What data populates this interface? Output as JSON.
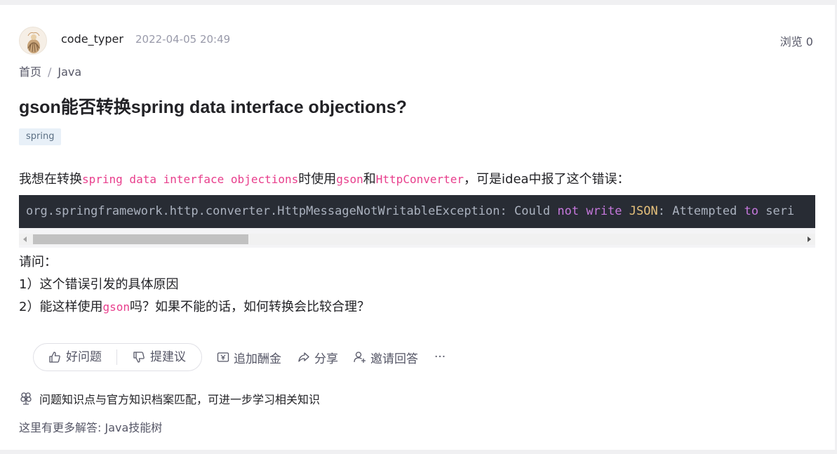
{
  "header": {
    "username": "code_typer",
    "timestamp": "2022-04-05 20:49",
    "views": "浏览 0"
  },
  "breadcrumb": {
    "home": "首页",
    "separator": "/",
    "category": "Java"
  },
  "question": {
    "title": "gson能否转换spring data interface objections?",
    "tag": "spring",
    "paragraph": [
      {
        "text": "我想在转换",
        "code": false
      },
      {
        "text": "spring data interface objections",
        "code": true
      },
      {
        "text": "时使用",
        "code": false
      },
      {
        "text": "gson",
        "code": true
      },
      {
        "text": "和",
        "code": false
      },
      {
        "text": "HttpConverter",
        "code": true
      },
      {
        "text": "，可是idea中报了这个错误：",
        "code": false
      }
    ],
    "code_tokens": [
      {
        "text": "org.springframework.http.converter.HttpMessageNotWritableException: Could ",
        "style": "plain"
      },
      {
        "text": "not",
        "style": "purple"
      },
      {
        "text": " ",
        "style": "plain"
      },
      {
        "text": "write",
        "style": "purple"
      },
      {
        "text": " ",
        "style": "plain"
      },
      {
        "text": "JSON",
        "style": "yellow"
      },
      {
        "text": ": Attempted ",
        "style": "plain"
      },
      {
        "text": "to",
        "style": "purple"
      },
      {
        "text": " seri",
        "style": "plain"
      }
    ],
    "ask_label": "请问：",
    "q1": "1）这个错误引发的具体原因",
    "q2_before": "2）能这样使用",
    "q2_code": "gson",
    "q2_after": "吗？如果不能的话，如何转换会比较合理？"
  },
  "actions": {
    "like": "好问题",
    "suggest": "提建议",
    "reward": "追加酬金",
    "share": "分享",
    "invite": "邀请回答",
    "more": "···"
  },
  "footer": {
    "knowledge_match": "问题知识点与官方知识档案匹配，可进一步学习相关知识",
    "more_answers": "这里有更多解答: Java技能树"
  },
  "colors": {
    "inline_code": "#e83e8c",
    "code_bg": "#282c34",
    "keyword": "#c678dd",
    "literal": "#e5c07b",
    "tag_bg": "#e8f0f8"
  }
}
